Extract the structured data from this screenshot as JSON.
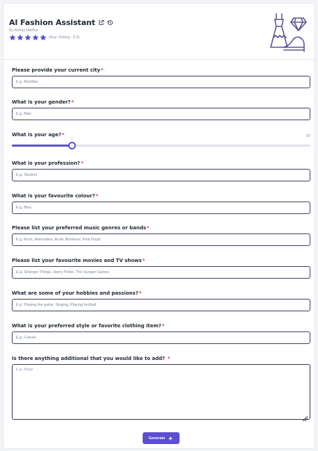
{
  "header": {
    "title": "AI Fashion Assistant",
    "byline": "By Abhay Mathur",
    "rating_text": "(Avg. Rating : 5.0)",
    "stars": 5,
    "accent": "#5a4fcf"
  },
  "fields": {
    "city": {
      "label": "Please provide your current city",
      "placeholder": "E.g. Mumbai"
    },
    "gender": {
      "label": "What is your gender?",
      "placeholder": "E.g. Man"
    },
    "age": {
      "label": "What is your age?",
      "value": "20",
      "min": 0,
      "max": 100
    },
    "profession": {
      "label": "What is your profession?",
      "placeholder": "E.g. Student"
    },
    "colour": {
      "label": "What is your favourite colour?",
      "placeholder": "E.g. Blue"
    },
    "music": {
      "label": "Please list your preferred music genres or bands",
      "placeholder": "E.g. Rock, Alternative, Arctic Monkeys, Pink Floyd"
    },
    "movies": {
      "label": "Please list your favourite movies and TV shows",
      "placeholder": "E.g. Stranger Things, Harry Potter, The Hunger Games"
    },
    "hobbies": {
      "label": "What are some of your hobbies and passions?",
      "placeholder": "E.g. Playing the guitar, Singing, Playing football"
    },
    "style": {
      "label": "What is your preferred style or favorite clothing item?",
      "placeholder": "E.g. Casual"
    },
    "additional": {
      "label": "Is there anything additional that you would like to add?",
      "placeholder": "E.g. Nope"
    }
  },
  "required_mark": "*",
  "generate_label": "Generate",
  "icons": {
    "share": "external-link-icon",
    "history": "history-icon",
    "star": "star-icon",
    "logo": "fashion-dress-heels-diamond-logo",
    "generate": "sparkle-icon"
  }
}
